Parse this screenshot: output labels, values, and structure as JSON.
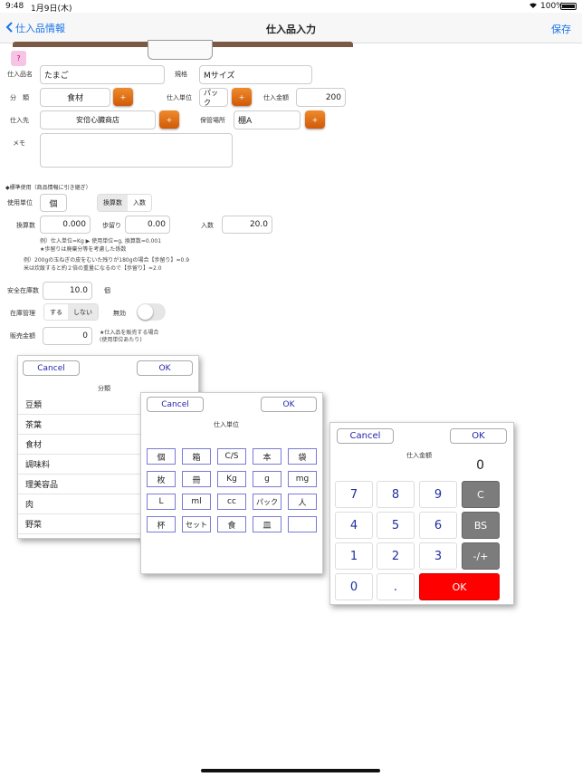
{
  "status": {
    "time": "9:48",
    "date": "1月9日(木)",
    "battery": "100%"
  },
  "nav": {
    "back_label": "仕入品情報",
    "title": "仕入品入力",
    "save_label": "保存"
  },
  "help_label": "?",
  "form": {
    "name_label": "仕入品名",
    "name_value": "たまご",
    "spec_label": "規格",
    "spec_value": "Mサイズ",
    "category_label": "分　類",
    "category_value": "食材",
    "unit_label": "仕入単位",
    "unit_value": "パック",
    "price_label": "仕入金額",
    "price_value": "200",
    "supplier_label": "仕入先",
    "supplier_value": "安倍心臓商店",
    "storage_label": "保管場所",
    "storage_value": "棚A",
    "memo_label": "メモ",
    "plus_label": "+",
    "standard_heading": "◆標準使用（商品情報に引き継ぎ）",
    "use_unit_label": "使用単位",
    "use_unit_value": "個",
    "seg_convert": "換算数",
    "seg_count": "入数",
    "convert_label": "換算数",
    "convert_value": "0.000",
    "yield_label": "歩留り",
    "yield_value": "0.00",
    "count_label": "入数",
    "count_value": "20.0",
    "note1": "例）仕入単位=Kg ▶ 使用単位=g, 換算数=0.001",
    "note2": "★歩留りは廃棄分等を考慮した係数",
    "note3": "例）200gの玉ねぎの皮をむいた残りが180gの場合【歩留り】=0.9",
    "note4": "米は炊飯すると約２倍の重量になるので【歩留り】=2.0",
    "safety_label": "安全在庫数",
    "safety_value": "10.0",
    "safety_unit": "個",
    "stock_label": "在庫管理",
    "stock_on": "する",
    "stock_off": "しない",
    "invalid_label": "無効",
    "sale_label": "販売金額",
    "sale_value": "0",
    "sale_note1": "★仕入品を販売する場合",
    "sale_note2": "(使用単位あたり)"
  },
  "category_popup": {
    "cancel": "Cancel",
    "ok": "OK",
    "title": "分類",
    "items": [
      "豆類",
      "茶葉",
      "食材",
      "調味料",
      "理美容品",
      "肉",
      "野菜"
    ]
  },
  "unit_popup": {
    "cancel": "Cancel",
    "ok": "OK",
    "title": "仕入単位",
    "units": [
      "個",
      "箱",
      "C/S",
      "本",
      "袋",
      "枚",
      "冊",
      "Kg",
      "g",
      "mg",
      "L",
      "ml",
      "cc",
      "パック",
      "人",
      "杯",
      "セット",
      "食",
      "皿",
      ""
    ]
  },
  "price_popup": {
    "cancel": "Cancel",
    "ok": "OK",
    "title": "仕入金額",
    "display": "0",
    "keys": [
      "7",
      "8",
      "9",
      "C",
      "4",
      "5",
      "6",
      "BS",
      "1",
      "2",
      "3",
      "-/+",
      "0",
      ".",
      "OK"
    ]
  }
}
